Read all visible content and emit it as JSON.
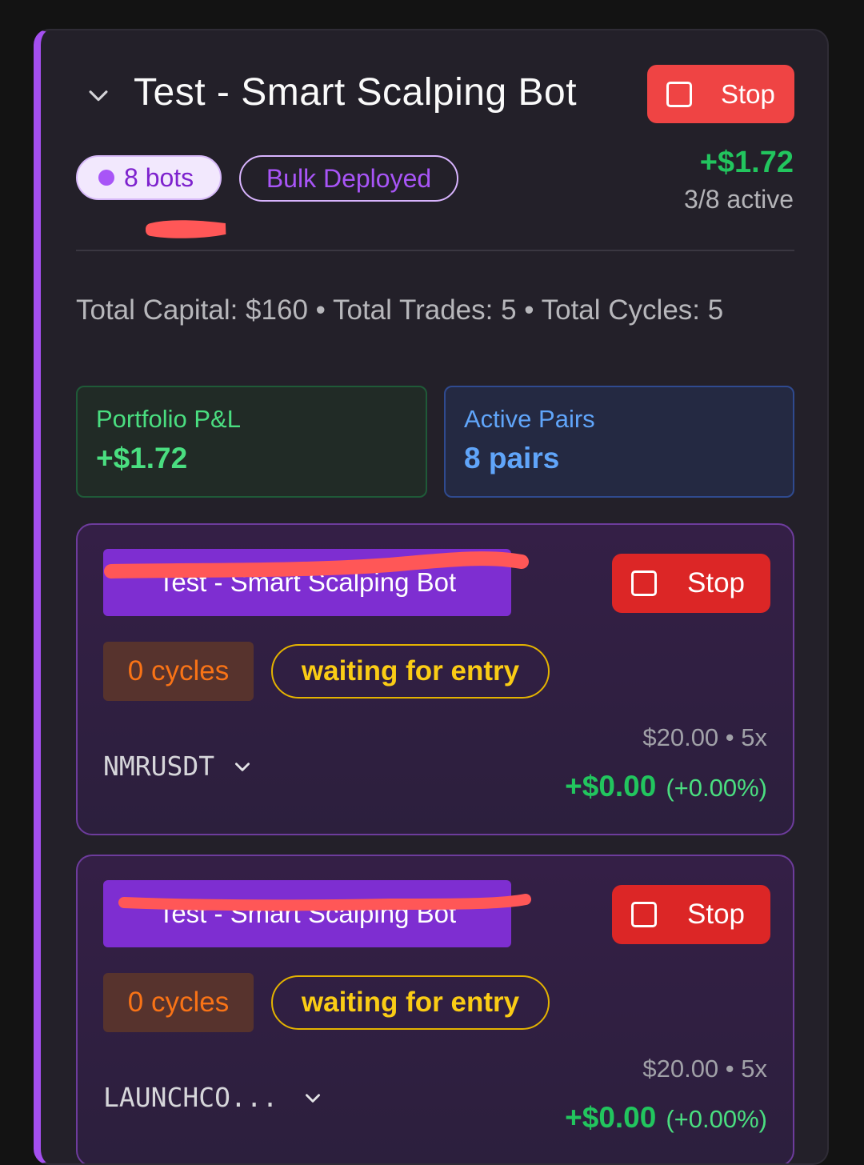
{
  "group": {
    "title": "Test - Smart Scalping Bot",
    "stop_label": "Stop",
    "bots_pill": "8 bots",
    "bulk_pill": "Bulk Deployed",
    "total_pnl": "+$1.72",
    "active_count": "3/8 active",
    "summary": "Total Capital: $160 • Total Trades: 5 • Total Cycles: 5"
  },
  "stats": {
    "portfolio_label": "Portfolio P&L",
    "portfolio_value": "+$1.72",
    "pairs_label": "Active Pairs",
    "pairs_value": "8 pairs"
  },
  "bots": [
    {
      "name": "Test - Smart Scalping Bot",
      "stop_label": "Stop",
      "cycles": "0 cycles",
      "status": "waiting for entry",
      "symbol": "NMRUSDT",
      "capital": "$20.00 • 5x",
      "pnl": "+$0.00",
      "pnl_pct": "(+0.00%)"
    },
    {
      "name": "Test - Smart Scalping Bot",
      "stop_label": "Stop",
      "cycles": "0 cycles",
      "status": "waiting for entry",
      "symbol": "LAUNCHCO...",
      "capital": "$20.00 • 5x",
      "pnl": "+$0.00",
      "pnl_pct": "(+0.00%)"
    }
  ],
  "colors": {
    "accent_purple": "#a44ff0",
    "stop_red": "#ef4444",
    "profit_green": "#22c55e",
    "info_blue": "#60a5fa",
    "warning_yellow": "#facc15"
  },
  "icons": [
    "chevron-down-icon",
    "stop-square-icon",
    "status-dot-icon"
  ]
}
